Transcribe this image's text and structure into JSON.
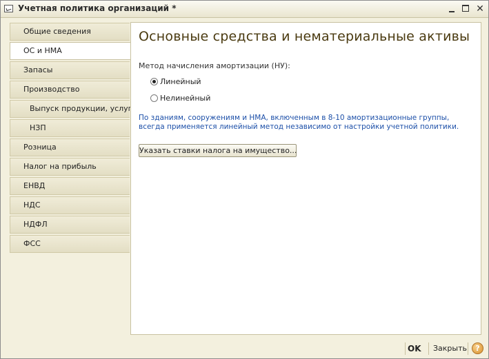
{
  "window": {
    "title": "Учетная политика организаций *",
    "minimize_icon": "minimize-icon",
    "maximize_icon": "maximize-icon",
    "close_icon": "close-icon"
  },
  "sidebar": {
    "items": [
      {
        "label": "Общие сведения",
        "active": false,
        "sub": false
      },
      {
        "label": "ОС и НМА",
        "active": true,
        "sub": false
      },
      {
        "label": "Запасы",
        "active": false,
        "sub": false
      },
      {
        "label": "Производство",
        "active": false,
        "sub": false
      },
      {
        "label": "Выпуск продукции, услуг",
        "active": false,
        "sub": true
      },
      {
        "label": "НЗП",
        "active": false,
        "sub": true
      },
      {
        "label": "Розница",
        "active": false,
        "sub": false
      },
      {
        "label": "Налог на прибыль",
        "active": false,
        "sub": false
      },
      {
        "label": "ЕНВД",
        "active": false,
        "sub": false
      },
      {
        "label": "НДС",
        "active": false,
        "sub": false
      },
      {
        "label": "НДФЛ",
        "active": false,
        "sub": false
      },
      {
        "label": "ФСС",
        "active": false,
        "sub": false
      }
    ]
  },
  "main": {
    "heading": "Основные средства и нематериальные активы",
    "method_label": "Метод начисления амортизации (НУ):",
    "radio_linear": "Линейный",
    "radio_nonlinear": "Нелинейный",
    "selected_method": "Линейный",
    "info_line1": "По зданиям, сооружениям и НМА, включенным в 8-10 амортизационные группы,",
    "info_line2": "всегда применяется линейный метод независимо от настройки учетной политики.",
    "tax_button": "Указать ставки налога на имущество..."
  },
  "footer": {
    "ok": "OK",
    "close": "Закрыть",
    "help": "?"
  },
  "colors": {
    "background": "#f3f0de",
    "heading": "#4a3a10",
    "info_text": "#1c4fa8",
    "help_icon": "#d9922f"
  }
}
